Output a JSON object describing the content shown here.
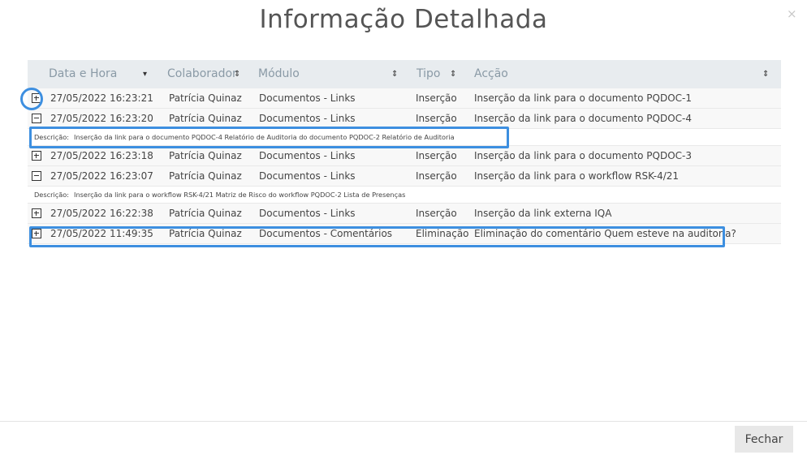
{
  "dialog": {
    "title": "Informação Detalhada",
    "close_symbol": "×",
    "close_button_label": "Fechar"
  },
  "table": {
    "columns": [
      {
        "label": "Data e Hora",
        "sort_icon": "▾"
      },
      {
        "label": "Colaborador",
        "sort_icon": "⇕"
      },
      {
        "label": "Módulo",
        "sort_icon": "⇕"
      },
      {
        "label": "Tipo",
        "sort_icon": "⇕"
      },
      {
        "label": "Acção",
        "sort_icon": "⇕"
      }
    ],
    "description_label": "Descrição:",
    "rows": [
      {
        "expanded": false,
        "datetime": "27/05/2022 16:23:21",
        "collaborator": "Patrícia Quinaz",
        "module": "Documentos - Links",
        "type": "Inserção",
        "action": "Inserção da link para o documento PQDOC-1",
        "description": ""
      },
      {
        "expanded": true,
        "datetime": "27/05/2022 16:23:20",
        "collaborator": "Patrícia Quinaz",
        "module": "Documentos - Links",
        "type": "Inserção",
        "action": "Inserção da link para o documento PQDOC-4",
        "description": "Inserção da link para o documento PQDOC-4 Relatório de Auditoria do documento PQDOC-2 Relatório de Auditoria"
      },
      {
        "expanded": false,
        "datetime": "27/05/2022 16:23:18",
        "collaborator": "Patrícia Quinaz",
        "module": "Documentos - Links",
        "type": "Inserção",
        "action": "Inserção da link para o documento PQDOC-3",
        "description": ""
      },
      {
        "expanded": true,
        "datetime": "27/05/2022 16:23:07",
        "collaborator": "Patrícia Quinaz",
        "module": "Documentos - Links",
        "type": "Inserção",
        "action": "Inserção da link para o workflow RSK-4/21",
        "description": "Inserção da link para o workflow RSK-4/21 Matriz de Risco do workflow PQDOC-2 Lista de Presenças"
      },
      {
        "expanded": false,
        "datetime": "27/05/2022 16:22:38",
        "collaborator": "Patrícia Quinaz",
        "module": "Documentos - Links",
        "type": "Inserção",
        "action": "Inserção da link externa IQA",
        "description": ""
      },
      {
        "expanded": false,
        "datetime": "27/05/2022 11:49:35",
        "collaborator": "Patrícia Quinaz",
        "module": "Documentos - Comentários",
        "type": "Eliminação",
        "action": "Eliminação do comentário Quem esteve na auditoria?",
        "description": ""
      }
    ]
  },
  "colors": {
    "header_bg": "#e8ecef",
    "row_bg": "#f8f8f8",
    "highlight": "#3d8fe0",
    "button_bg": "#e8e8e8"
  }
}
